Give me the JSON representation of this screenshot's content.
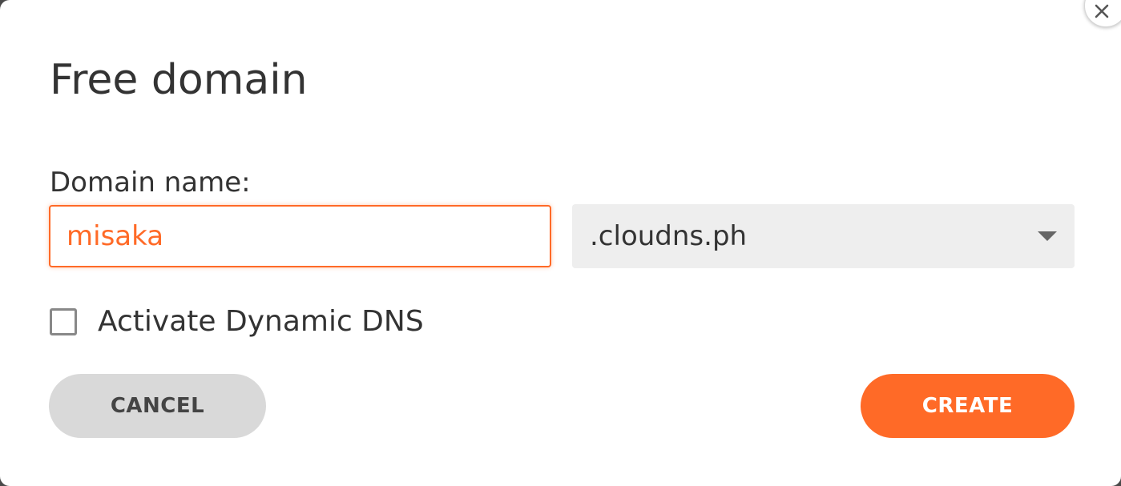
{
  "dialog": {
    "title": "Free domain",
    "close_icon": "close-icon"
  },
  "form": {
    "domain_label": "Domain name:",
    "domain_value": "misaka",
    "zone_selected": ".cloudns.ph",
    "zone_caret_icon": "caret-down-icon",
    "dynamic_dns_label": "Activate Dynamic DNS",
    "dynamic_dns_checked": false
  },
  "actions": {
    "cancel_label": "CANCEL",
    "create_label": "CREATE"
  },
  "colors": {
    "accent": "#ff6a27",
    "cancel_bg": "#d9d9d9",
    "select_bg": "#eeeeee",
    "text": "#333333"
  }
}
